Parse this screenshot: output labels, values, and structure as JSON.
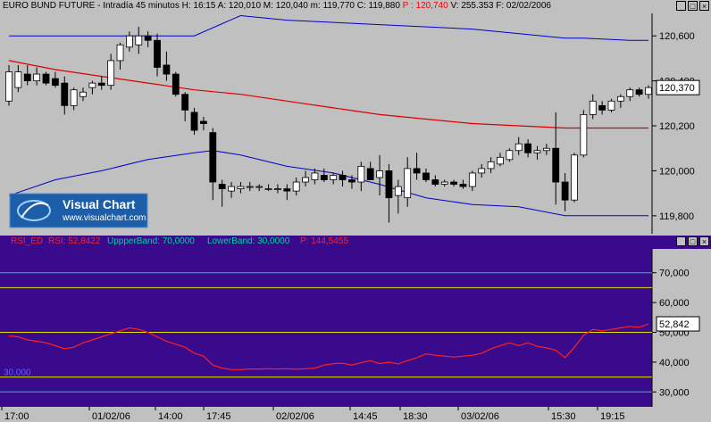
{
  "price_pane": {
    "title": "EURO BUND FUTURE - Intradía 45 minutos",
    "stats": [
      {
        "label": "H:",
        "value": "16:15",
        "color": "#000000"
      },
      {
        "label": "A:",
        "value": "120,010",
        "color": "#000000"
      },
      {
        "label": "M:",
        "value": "120,040",
        "color": "#000000"
      },
      {
        "label": "m:",
        "value": "119,770",
        "color": "#000000"
      },
      {
        "label": "C:",
        "value": "119,880",
        "color": "#000000"
      },
      {
        "label": "P :",
        "value": "120,740",
        "color": "#ff0000"
      },
      {
        "label": "V:",
        "value": "255.353",
        "color": "#000000"
      },
      {
        "label": "F:",
        "value": "02/02/2006",
        "color": "#000000"
      }
    ],
    "watermark": {
      "title": "Visual Chart",
      "url": "www.visualchart.com"
    },
    "window_buttons": [
      "_",
      "□",
      "×"
    ]
  },
  "rsi_pane": {
    "legend": [
      {
        "label": "RSI_ED",
        "color": "#ff2020"
      },
      {
        "label": "RSI:",
        "value": "52,8422",
        "color": "#ff2020"
      },
      {
        "label": "UppperBand:",
        "value": "70,0000",
        "color": "#00d4a0"
      },
      {
        "label": "LowerBand:",
        "value": "30,0000",
        "color": "#00d4a0"
      },
      {
        "label": "P:",
        "value": "144,5455",
        "color": "#ff2020"
      }
    ],
    "left_label": "30,000",
    "window_buttons": [
      "_",
      "□",
      "×"
    ]
  },
  "colors": {
    "price_bg": "#c0c0c0",
    "rsi_bg": "#3a0a8c",
    "upper_band": "#0000cc",
    "lower_band": "#0000cc",
    "moving_average": "#dd0000",
    "rsi_line": "#ff2020",
    "rsi_bands": "#00d4a0",
    "rsi_level_lines": "#e0e000"
  },
  "time_axis": [
    "17:00",
    "01/02/06",
    "14:00",
    "17:45",
    "02/02/06",
    "14:45",
    "18:30",
    "03/02/06",
    "15:30",
    "19:15"
  ],
  "chart_data": [
    {
      "type": "candlestick",
      "title": "EURO BUND FUTURE - Intradía 45 minutos",
      "ylim": [
        119.72,
        120.7
      ],
      "yticks": [
        "120,600",
        "120,400",
        "120,200",
        "120,000",
        "119,800"
      ],
      "last_value": "120,370",
      "candles": [
        {
          "o": 120.31,
          "h": 120.47,
          "l": 120.29,
          "c": 120.44
        },
        {
          "o": 120.37,
          "h": 120.47,
          "l": 120.35,
          "c": 120.44
        },
        {
          "o": 120.43,
          "h": 120.47,
          "l": 120.38,
          "c": 120.4
        },
        {
          "o": 120.4,
          "h": 120.46,
          "l": 120.38,
          "c": 120.43
        },
        {
          "o": 120.43,
          "h": 120.44,
          "l": 120.38,
          "c": 120.39
        },
        {
          "o": 120.41,
          "h": 120.44,
          "l": 120.37,
          "c": 120.38
        },
        {
          "o": 120.39,
          "h": 120.42,
          "l": 120.25,
          "c": 120.29
        },
        {
          "o": 120.29,
          "h": 120.37,
          "l": 120.27,
          "c": 120.36
        },
        {
          "o": 120.33,
          "h": 120.37,
          "l": 120.31,
          "c": 120.35
        },
        {
          "o": 120.37,
          "h": 120.4,
          "l": 120.34,
          "c": 120.39
        },
        {
          "o": 120.39,
          "h": 120.42,
          "l": 120.36,
          "c": 120.38
        },
        {
          "o": 120.38,
          "h": 120.52,
          "l": 120.36,
          "c": 120.49
        },
        {
          "o": 120.49,
          "h": 120.57,
          "l": 120.45,
          "c": 120.56
        },
        {
          "o": 120.55,
          "h": 120.62,
          "l": 120.53,
          "c": 120.6
        },
        {
          "o": 120.56,
          "h": 120.64,
          "l": 120.52,
          "c": 120.6
        },
        {
          "o": 120.6,
          "h": 120.62,
          "l": 120.55,
          "c": 120.58
        },
        {
          "o": 120.58,
          "h": 120.61,
          "l": 120.42,
          "c": 120.46
        },
        {
          "o": 120.47,
          "h": 120.53,
          "l": 120.4,
          "c": 120.43
        },
        {
          "o": 120.43,
          "h": 120.44,
          "l": 120.33,
          "c": 120.34
        },
        {
          "o": 120.34,
          "h": 120.35,
          "l": 120.22,
          "c": 120.27
        },
        {
          "o": 120.26,
          "h": 120.28,
          "l": 120.16,
          "c": 120.18
        },
        {
          "o": 120.22,
          "h": 120.24,
          "l": 120.18,
          "c": 120.21
        },
        {
          "o": 120.17,
          "h": 120.19,
          "l": 119.87,
          "c": 119.95
        },
        {
          "o": 119.94,
          "h": 119.96,
          "l": 119.84,
          "c": 119.92
        },
        {
          "o": 119.91,
          "h": 119.95,
          "l": 119.88,
          "c": 119.93
        },
        {
          "o": 119.92,
          "h": 119.95,
          "l": 119.9,
          "c": 119.93
        },
        {
          "o": 119.93,
          "h": 119.95,
          "l": 119.91,
          "c": 119.93
        },
        {
          "o": 119.93,
          "h": 119.94,
          "l": 119.91,
          "c": 119.93
        },
        {
          "o": 119.92,
          "h": 119.94,
          "l": 119.91,
          "c": 119.92
        },
        {
          "o": 119.92,
          "h": 119.94,
          "l": 119.9,
          "c": 119.92
        },
        {
          "o": 119.92,
          "h": 119.94,
          "l": 119.87,
          "c": 119.91
        },
        {
          "o": 119.91,
          "h": 119.97,
          "l": 119.89,
          "c": 119.95
        },
        {
          "o": 119.95,
          "h": 120.0,
          "l": 119.93,
          "c": 119.97
        },
        {
          "o": 119.96,
          "h": 120.01,
          "l": 119.94,
          "c": 119.99
        },
        {
          "o": 119.98,
          "h": 120.01,
          "l": 119.95,
          "c": 119.96
        },
        {
          "o": 119.96,
          "h": 119.99,
          "l": 119.94,
          "c": 119.98
        },
        {
          "o": 119.98,
          "h": 120.0,
          "l": 119.93,
          "c": 119.96
        },
        {
          "o": 119.96,
          "h": 119.98,
          "l": 119.92,
          "c": 119.95
        },
        {
          "o": 119.95,
          "h": 120.04,
          "l": 119.91,
          "c": 120.02
        },
        {
          "o": 120.01,
          "h": 120.04,
          "l": 119.96,
          "c": 119.96
        },
        {
          "o": 119.97,
          "h": 120.07,
          "l": 119.89,
          "c": 120.0
        },
        {
          "o": 120.0,
          "h": 120.03,
          "l": 119.77,
          "c": 119.88
        },
        {
          "o": 119.89,
          "h": 119.96,
          "l": 119.81,
          "c": 119.93
        },
        {
          "o": 119.88,
          "h": 120.06,
          "l": 119.84,
          "c": 120.01
        },
        {
          "o": 120.01,
          "h": 120.08,
          "l": 119.96,
          "c": 119.99
        },
        {
          "o": 119.99,
          "h": 120.01,
          "l": 119.95,
          "c": 119.96
        },
        {
          "o": 119.96,
          "h": 119.98,
          "l": 119.93,
          "c": 119.94
        },
        {
          "o": 119.94,
          "h": 119.96,
          "l": 119.93,
          "c": 119.95
        },
        {
          "o": 119.95,
          "h": 119.96,
          "l": 119.93,
          "c": 119.94
        },
        {
          "o": 119.94,
          "h": 119.96,
          "l": 119.92,
          "c": 119.93
        },
        {
          "o": 119.93,
          "h": 120.0,
          "l": 119.91,
          "c": 119.99
        },
        {
          "o": 119.99,
          "h": 120.03,
          "l": 119.97,
          "c": 120.01
        },
        {
          "o": 120.01,
          "h": 120.06,
          "l": 119.99,
          "c": 120.04
        },
        {
          "o": 120.03,
          "h": 120.08,
          "l": 120.02,
          "c": 120.06
        },
        {
          "o": 120.05,
          "h": 120.1,
          "l": 120.04,
          "c": 120.09
        },
        {
          "o": 120.09,
          "h": 120.15,
          "l": 120.07,
          "c": 120.12
        },
        {
          "o": 120.12,
          "h": 120.14,
          "l": 120.06,
          "c": 120.08
        },
        {
          "o": 120.08,
          "h": 120.11,
          "l": 120.05,
          "c": 120.09
        },
        {
          "o": 120.09,
          "h": 120.12,
          "l": 120.07,
          "c": 120.1
        },
        {
          "o": 120.1,
          "h": 120.26,
          "l": 119.85,
          "c": 119.95
        },
        {
          "o": 119.95,
          "h": 119.99,
          "l": 119.82,
          "c": 119.87
        },
        {
          "o": 119.87,
          "h": 120.08,
          "l": 119.86,
          "c": 120.07
        },
        {
          "o": 120.07,
          "h": 120.27,
          "l": 120.06,
          "c": 120.25
        },
        {
          "o": 120.25,
          "h": 120.34,
          "l": 120.23,
          "c": 120.31
        },
        {
          "o": 120.29,
          "h": 120.31,
          "l": 120.25,
          "c": 120.27
        },
        {
          "o": 120.27,
          "h": 120.32,
          "l": 120.26,
          "c": 120.31
        },
        {
          "o": 120.31,
          "h": 120.34,
          "l": 120.28,
          "c": 120.33
        },
        {
          "o": 120.33,
          "h": 120.37,
          "l": 120.31,
          "c": 120.36
        },
        {
          "o": 120.36,
          "h": 120.37,
          "l": 120.33,
          "c": 120.34
        },
        {
          "o": 120.34,
          "h": 120.38,
          "l": 120.32,
          "c": 120.37
        }
      ],
      "upper_band": [
        [
          0,
          120.6
        ],
        [
          10,
          120.6
        ],
        [
          20,
          120.6
        ],
        [
          25,
          120.69
        ],
        [
          30,
          120.67
        ],
        [
          40,
          120.65
        ],
        [
          50,
          120.63
        ],
        [
          60,
          120.59
        ],
        [
          62,
          120.59
        ],
        [
          67,
          120.58
        ],
        [
          69,
          120.58
        ]
      ],
      "lower_band": [
        [
          0,
          119.89
        ],
        [
          5,
          119.96
        ],
        [
          10,
          120.0
        ],
        [
          15,
          120.05
        ],
        [
          20,
          120.08
        ],
        [
          22,
          120.09
        ],
        [
          25,
          120.07
        ],
        [
          30,
          120.02
        ],
        [
          35,
          119.99
        ],
        [
          40,
          119.94
        ],
        [
          45,
          119.88
        ],
        [
          50,
          119.85
        ],
        [
          55,
          119.84
        ],
        [
          60,
          119.8
        ],
        [
          65,
          119.8
        ],
        [
          69,
          119.8
        ]
      ],
      "moving_average": [
        [
          0,
          120.49
        ],
        [
          5,
          120.45
        ],
        [
          10,
          120.42
        ],
        [
          15,
          120.39
        ],
        [
          20,
          120.36
        ],
        [
          25,
          120.34
        ],
        [
          30,
          120.31
        ],
        [
          35,
          120.28
        ],
        [
          40,
          120.25
        ],
        [
          45,
          120.23
        ],
        [
          50,
          120.21
        ],
        [
          55,
          120.2
        ],
        [
          60,
          120.19
        ],
        [
          62,
          120.19
        ],
        [
          65,
          120.19
        ],
        [
          69,
          120.19
        ]
      ]
    },
    {
      "type": "line",
      "title": "RSI_ED",
      "ylim": [
        25,
        78
      ],
      "yticks": [
        "70,000",
        "60,000",
        "50,000",
        "40,000",
        "30,000"
      ],
      "upper_band": 70,
      "lower_band": 30,
      "extra_levels": [
        65,
        50,
        35
      ],
      "last_value": "52,842",
      "series": [
        {
          "name": "RSI_ED",
          "values": [
            48.8,
            48.5,
            47.5,
            47.0,
            46.5,
            45.5,
            44.5,
            45.0,
            46.5,
            47.5,
            48.5,
            49.5,
            50.5,
            51.5,
            51.0,
            50.0,
            48.5,
            47.0,
            46.0,
            45.0,
            43.0,
            42.0,
            39.0,
            38.0,
            37.5,
            37.5,
            37.7,
            37.7,
            37.8,
            37.7,
            37.8,
            37.6,
            37.8,
            38.0,
            39.0,
            39.5,
            39.6,
            39.0,
            39.8,
            40.5,
            39.5,
            40.0,
            39.4,
            40.5,
            41.5,
            42.8,
            42.3,
            42.0,
            41.7,
            42.0,
            42.3,
            43.0,
            44.5,
            45.5,
            46.5,
            45.5,
            46.5,
            45.3,
            44.8,
            44.0,
            41.5,
            45.0,
            49.0,
            51.0,
            50.5,
            51.0,
            51.5,
            52.0,
            51.7,
            52.8
          ]
        }
      ]
    }
  ]
}
